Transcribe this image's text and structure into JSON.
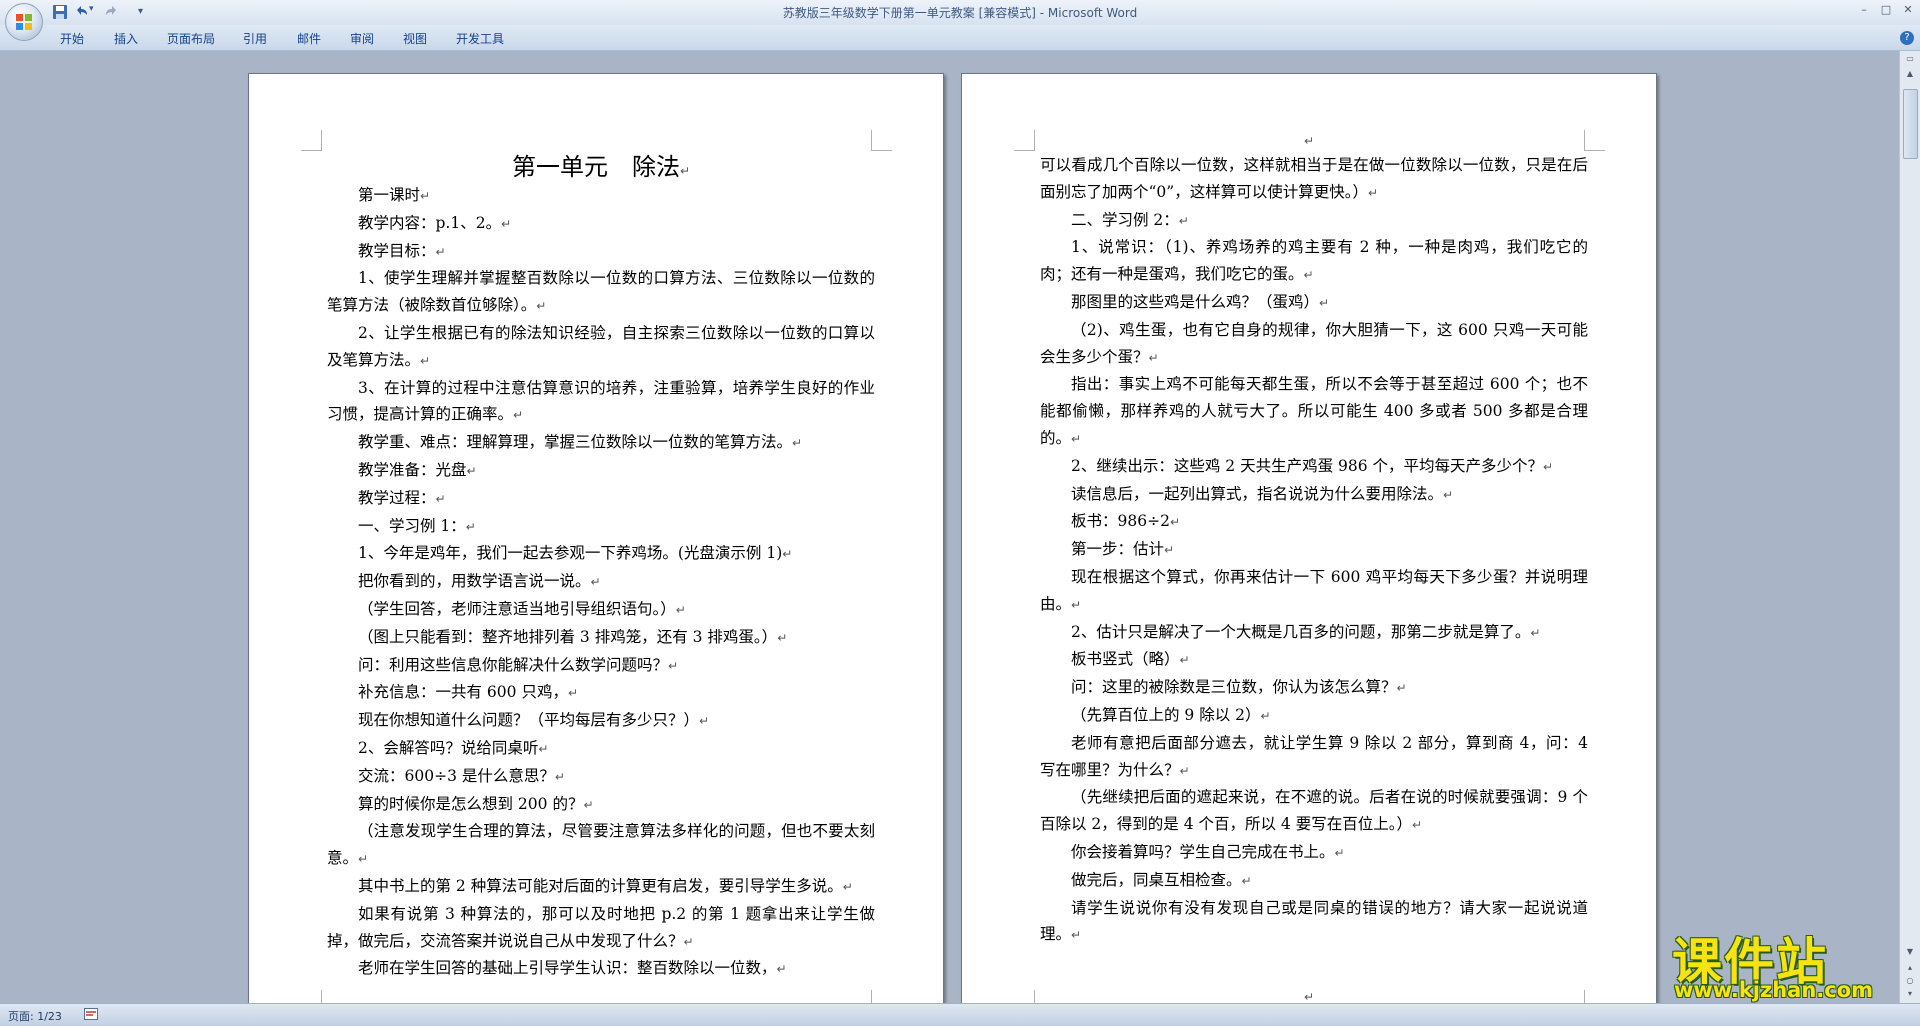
{
  "window": {
    "title": "苏教版三年级数学下册第一单元教案 [兼容模式] - Microsoft Word",
    "minimize": "–",
    "maximize": "□",
    "close": "✕"
  },
  "quick_access": {
    "icons": [
      "save-icon",
      "undo-icon",
      "redo-icon",
      "customize-icon"
    ],
    "customize_glyph": "▾"
  },
  "ribbon": {
    "tabs": [
      "开始",
      "插入",
      "页面布局",
      "引用",
      "邮件",
      "审阅",
      "视图",
      "开发工具"
    ],
    "help": "?"
  },
  "page1": {
    "title": "第一单元　除法",
    "paragraphs": [
      "第一课时",
      "教学内容：p.1、2。",
      "教学目标：",
      "1、使学生理解并掌握整百数除以一位数的口算方法、三位数除以一位数的笔算方法（被除数首位够除）。",
      "2、让学生根据已有的除法知识经验，自主探索三位数除以一位数的口算以及笔算方法。",
      "3、在计算的过程中注意估算意识的培养，注重验算，培养学生良好的作业习惯，提高计算的正确率。",
      "教学重、难点：理解算理，掌握三位数除以一位数的笔算方法。",
      "教学准备：光盘",
      "教学过程：",
      "一、学习例 1：",
      "1、今年是鸡年，我们一起去参观一下养鸡场。(光盘演示例 1)",
      "把你看到的，用数学语言说一说。",
      "（学生回答，老师注意适当地引导组织语句。）",
      "（图上只能看到：整齐地排列着 3 排鸡笼，还有 3 排鸡蛋。）",
      "问：利用这些信息你能解决什么数学问题吗？",
      "补充信息：一共有 600 只鸡，",
      "现在你想知道什么问题？（平均每层有多少只？）",
      "2、会解答吗？说给同桌听",
      "交流：600÷3 是什么意思？",
      "算的时候你是怎么想到 200 的？",
      "（注意发现学生合理的算法，尽管要注意算法多样化的问题，但也不要太刻意。",
      "其中书上的第 2 种算法可能对后面的计算更有启发，要引导学生多说。",
      "如果有说第 3 种算法的，那可以及时地把 p.2 的第 1 题拿出来让学生做掉，做完后，交流答案并说说自己从中发现了什么？",
      "老师在学生回答的基础上引导学生认识：整百数除以一位数，"
    ]
  },
  "page2": {
    "first_paragraph": "可以看成几个百除以一位数，这样就相当于是在做一位数除以一位数，只是在后面别忘了加两个“0”，这样算可以使计算更快。）",
    "paragraphs": [
      "二、学习例 2：",
      "1、说常识：（1)、养鸡场养的鸡主要有 2 种，一种是肉鸡，我们吃它的肉；还有一种是蛋鸡，我们吃它的蛋。",
      "那图里的这些鸡是什么鸡？（蛋鸡）",
      "（2)、鸡生蛋，也有它自身的规律，你大胆猜一下，这 600 只鸡一天可能会生多少个蛋？",
      "指出：事实上鸡不可能每天都生蛋，所以不会等于甚至超过 600 个；也不能都偷懒，那样养鸡的人就亏大了。所以可能生 400 多或者 500 多都是合理的。",
      "2、继续出示：这些鸡 2 天共生产鸡蛋 986 个，平均每天产多少个？",
      "读信息后，一起列出算式，指名说说为什么要用除法。",
      "板书：986÷2",
      "第一步：估计",
      "现在根据这个算式，你再来估计一下 600 鸡平均每天下多少蛋？并说明理由。",
      "2、估计只是解决了一个大概是几百多的问题，那第二步就是算了。",
      "板书竖式（略）",
      "问：这里的被除数是三位数，你认为该怎么算？",
      "（先算百位上的 9 除以 2）",
      "老师有意把后面部分遮去，就让学生算 9 除以 2 部分，算到商 4，问：4 写在哪里？为什么？",
      "（先继续把后面的遮起来说，在不遮的说。后者在说的时候就要强调：9 个百除以 2，得到的是 4 个百，所以 4 要写在百位上。）",
      "你会接着算吗？学生自己完成在书上。",
      "做完后，同桌互相检查。",
      "请学生说说你有没有发现自己或是同桌的错误的地方？请大家一起说说道理。"
    ]
  },
  "paragraph_mark": "↵",
  "status": {
    "page_label": "页面: 1/23"
  },
  "watermark": {
    "name": "课件站",
    "url": "www.kjzhan.com"
  }
}
